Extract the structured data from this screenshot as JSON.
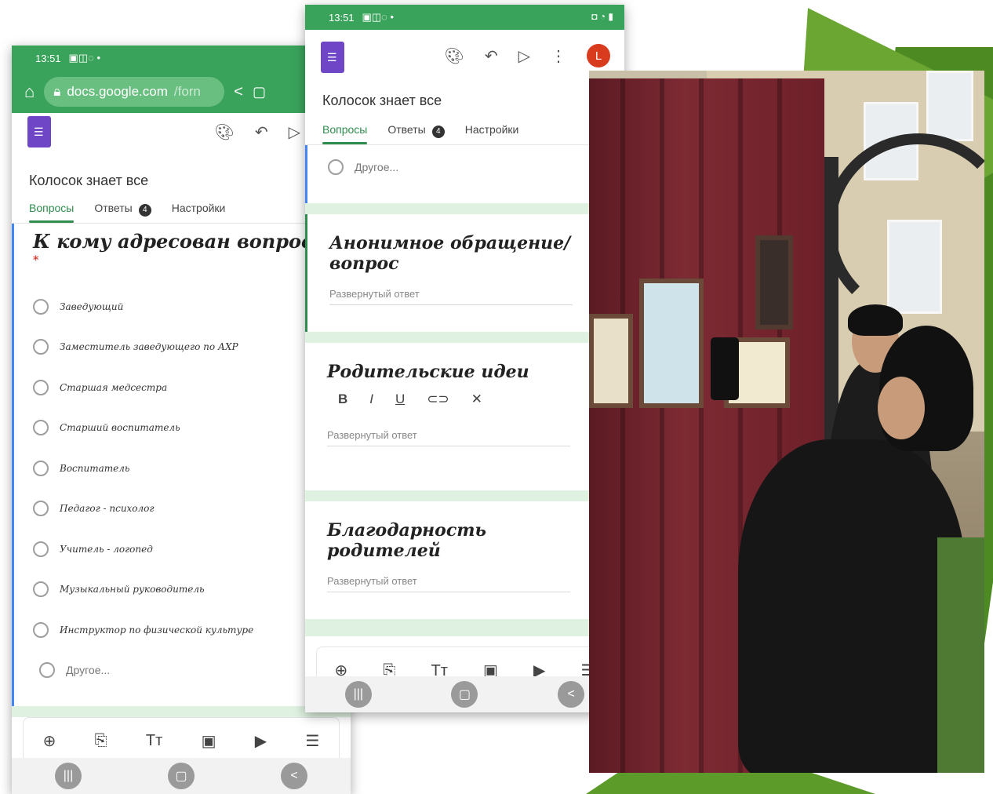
{
  "phone1": {
    "status_time": "13:51",
    "url_domain": "docs.google.com",
    "url_path": "/forn",
    "form_title": "Колосок знает все",
    "tabs": {
      "questions": "Вопросы",
      "answers": "Ответы",
      "answers_count": "4",
      "settings": "Настройки"
    },
    "question": {
      "title": "К кому адресован вопрос ?",
      "required_mark": "*",
      "options": [
        "Заведующий",
        "Заместитель заведующего по АХР",
        "Старшая медсестра",
        "Старший воспитатель",
        "Воспитатель",
        "Педагог - психолог",
        "Учитель - логопед",
        "Музыкальный руководитель",
        "Инструктор по физической культуре"
      ],
      "other_option": "Другое..."
    }
  },
  "phone2": {
    "status_time": "13:51",
    "avatar_letter": "L",
    "form_title": "Колосок знает все",
    "tabs": {
      "questions": "Вопросы",
      "answers": "Ответы",
      "answers_count": "4",
      "settings": "Настройки"
    },
    "other_option": "Другое...",
    "cards": [
      {
        "title": "Анонимное обращение/вопрос",
        "placeholder": "Развернутый ответ"
      },
      {
        "title": "Родительские идеи",
        "placeholder": "Развернутый ответ"
      },
      {
        "title": "Благодарность родителей",
        "placeholder": "Развернутый ответ"
      }
    ],
    "format_tools": {
      "bold": "B",
      "italic": "I",
      "underline": "U"
    }
  },
  "icons": {
    "home": "home-icon",
    "lock": "lock-icon",
    "share": "share-icon",
    "palette": "palette-icon",
    "undo": "undo-icon",
    "send": "send-icon",
    "more": "more-vertical-icon",
    "add": "add-circle-icon",
    "import": "import-question-icon",
    "title": "title-text-icon",
    "image": "image-icon",
    "video": "video-icon",
    "section": "section-icon",
    "recents": "recents-icon",
    "home_nav": "home-nav-icon",
    "back": "back-icon"
  }
}
